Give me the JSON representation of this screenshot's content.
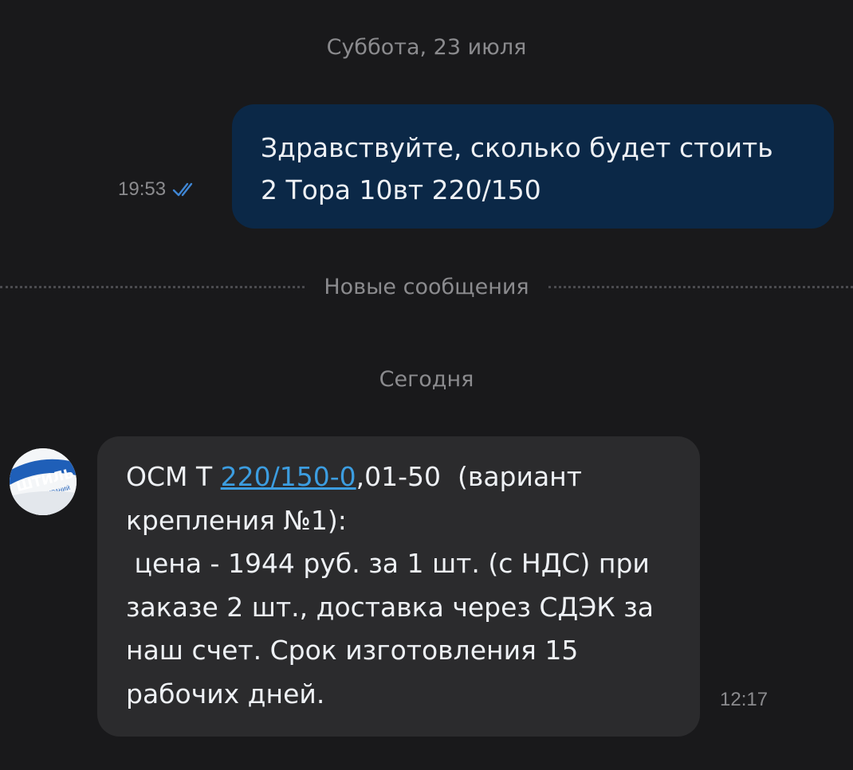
{
  "colors": {
    "background": "#19191b",
    "outgoing_bubble": "#0b2847",
    "incoming_bubble": "#2b2b2d",
    "link": "#3c9de0",
    "meta_text": "#8b8b8e",
    "read_check": "#3f86d4"
  },
  "separators": {
    "saturday": "Суббота, 23 июля",
    "new_messages": "Новые сообщения",
    "today": "Сегодня"
  },
  "outgoing_message": {
    "time": "19:53",
    "status_icon": "double-check-icon",
    "text": "Здравствуйте, сколько будет стоить\n2 Тора 10вт 220/150"
  },
  "incoming_message": {
    "avatar_icon": "company-logo-avatar",
    "avatar_logo_text": "ШТИЛЬ",
    "avatar_logo_subtext": "ГРУППА КОМПАНИЙ",
    "prefix": "ОСМ Т ",
    "link_text": "220/150-0",
    "text_rest": ",01-50  (вариант крепления №1):\n цена - 1944 руб. за 1 шт. (с НДС) при заказе 2 шт., доставка через СДЭК за наш счет. Срок изготовления 15 рабочих дней.",
    "time": "12:17"
  }
}
